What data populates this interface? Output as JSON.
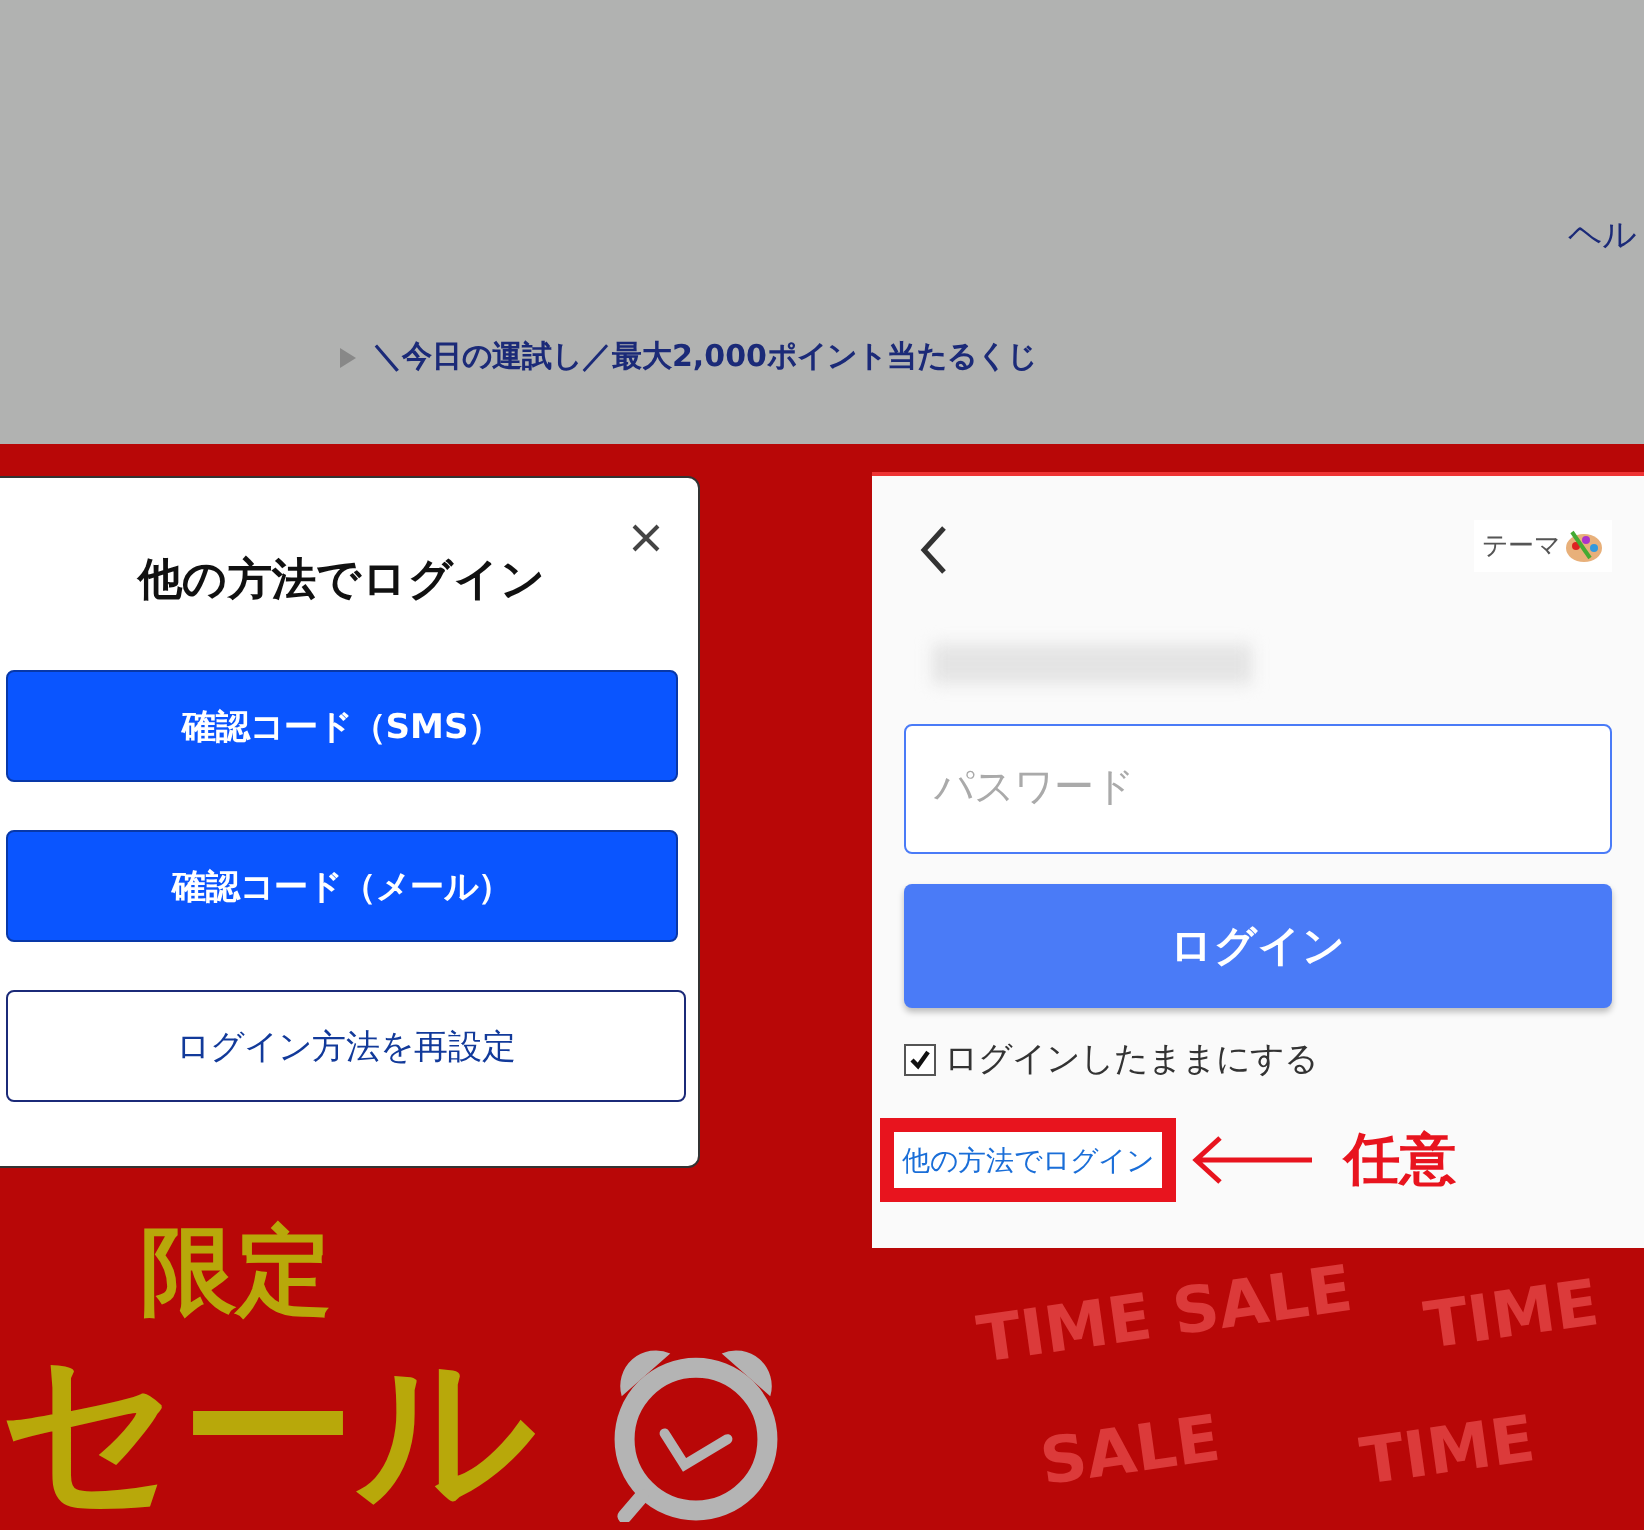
{
  "header": {
    "help_link": "ヘル",
    "campaign_link": "＼今日の運試し／最大2,000ポイント当たるくじ"
  },
  "banner": {
    "title_line_1": "限定",
    "title_line_2": "セール",
    "pattern_texts": [
      "TIME SALE",
      "TIME",
      "SALE",
      "TIME"
    ]
  },
  "login_methods_dialog": {
    "title": "他の方法でログイン",
    "buttons": [
      {
        "label": "確認コード（SMS）",
        "kind": "primary"
      },
      {
        "label": "確認コード（メール）",
        "kind": "primary"
      },
      {
        "label": "ログイン方法を再設定",
        "kind": "outline"
      }
    ]
  },
  "login_panel": {
    "theme_button": "テーマ",
    "password": {
      "placeholder": "パスワード"
    },
    "login_button": "ログイン",
    "keep_logged_in": {
      "label": "ログインしたままにする",
      "checked": true
    },
    "other_methods_link": "他の方法でログイン"
  },
  "annotation": {
    "label": "任意"
  }
}
